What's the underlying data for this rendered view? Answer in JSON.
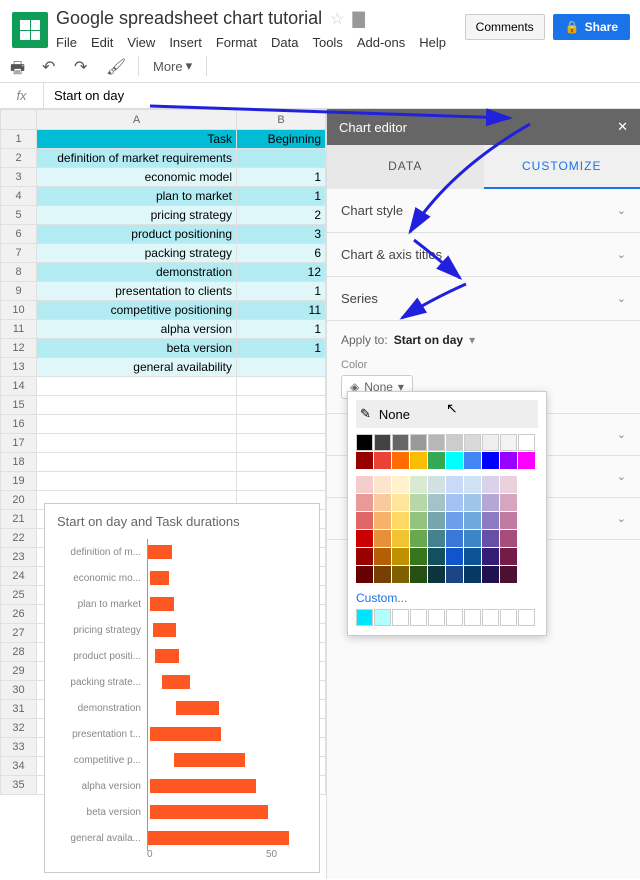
{
  "doc_title": "Google spreadsheet chart tutorial",
  "menus": [
    "File",
    "Edit",
    "View",
    "Insert",
    "Format",
    "Data",
    "Tools",
    "Add-ons",
    "Help"
  ],
  "buttons": {
    "comments": "Comments",
    "share": "Share"
  },
  "toolbar": {
    "more": "More"
  },
  "formula": {
    "fx": "fx",
    "value": "Start on day"
  },
  "columns": [
    "A",
    "B"
  ],
  "headers": {
    "task": "Task",
    "beginning": "Beginning"
  },
  "rows": [
    {
      "n": 1,
      "task": "Task",
      "b": "Beginning",
      "hdr": true
    },
    {
      "n": 2,
      "task": "definition of market requirements",
      "b": ""
    },
    {
      "n": 3,
      "task": "economic model",
      "b": "1"
    },
    {
      "n": 4,
      "task": "plan to market",
      "b": "1"
    },
    {
      "n": 5,
      "task": "pricing strategy",
      "b": "2"
    },
    {
      "n": 6,
      "task": "product positioning",
      "b": "3"
    },
    {
      "n": 7,
      "task": "packing strategy",
      "b": "6"
    },
    {
      "n": 8,
      "task": "demonstration",
      "b": "12"
    },
    {
      "n": 9,
      "task": "presentation to clients",
      "b": "1"
    },
    {
      "n": 10,
      "task": "competitive positioning",
      "b": "11"
    },
    {
      "n": 11,
      "task": "alpha version",
      "b": "1"
    },
    {
      "n": 12,
      "task": "beta version",
      "b": "1"
    },
    {
      "n": 13,
      "task": "general availability",
      "b": ""
    }
  ],
  "empty_rows": [
    14,
    15,
    16,
    17,
    18,
    19,
    20,
    21,
    22,
    23,
    24,
    25,
    26,
    27,
    28,
    29,
    30,
    31,
    32,
    33,
    34,
    35
  ],
  "chart_data": {
    "type": "bar",
    "title": "Start on day and Task durations",
    "categories": [
      "definition of m...",
      "economic mo...",
      "plan to market",
      "pricing strategy",
      "product positi...",
      "packing strate...",
      "demonstration",
      "presentation t...",
      "competitive p...",
      "alpha version",
      "beta version",
      "general availa..."
    ],
    "series": [
      {
        "name": "Start on day",
        "values": [
          0,
          1,
          1,
          2,
          3,
          6,
          12,
          1,
          11,
          1,
          1,
          0
        ]
      },
      {
        "name": "Task durations",
        "values": [
          10,
          8,
          10,
          10,
          10,
          12,
          18,
          30,
          30,
          45,
          50,
          60
        ]
      }
    ],
    "xlabel": "",
    "ylabel": "",
    "xlim": [
      0,
      70
    ],
    "ticks": [
      "0",
      "50"
    ]
  },
  "editor": {
    "title": "Chart editor",
    "tabs": {
      "data": "DATA",
      "customize": "CUSTOMIZE"
    },
    "sections": {
      "chart_style": "Chart style",
      "axis_titles": "Chart & axis titles",
      "series": "Series"
    },
    "apply_to_label": "Apply to:",
    "apply_to_value": "Start on day",
    "color_label": "Color",
    "none": "None",
    "custom": "Custom..."
  },
  "palette": {
    "grays": [
      "#000000",
      "#434343",
      "#666666",
      "#999999",
      "#b7b7b7",
      "#cccccc",
      "#d9d9d9",
      "#efefef",
      "#f3f3f3",
      "#ffffff"
    ],
    "brights": [
      "#ea4335",
      "#ff6d01",
      "#fbbc04",
      "#34a853",
      "#00ffff",
      "#4285f4",
      "#0000ff",
      "#9900ff",
      "#ff00ff"
    ],
    "tones": [
      [
        "#f4cccc",
        "#fce5cd",
        "#fff2cc",
        "#d9ead3",
        "#d0e0e3",
        "#c9daf8",
        "#cfe2f3",
        "#d9d2e9",
        "#ead1dc"
      ],
      [
        "#ea9999",
        "#f9cb9c",
        "#ffe599",
        "#b6d7a8",
        "#a2c4c9",
        "#a4c2f4",
        "#9fc5e8",
        "#b4a7d6",
        "#d5a6bd"
      ],
      [
        "#e06666",
        "#f6b26b",
        "#ffd966",
        "#93c47d",
        "#76a5af",
        "#6d9eeb",
        "#6fa8dc",
        "#8e7cc3",
        "#c27ba0"
      ],
      [
        "#cc0000",
        "#e69138",
        "#f1c232",
        "#6aa84f",
        "#45818e",
        "#3c78d8",
        "#3d85c6",
        "#674ea7",
        "#a64d79"
      ],
      [
        "#990000",
        "#b45f06",
        "#bf9000",
        "#38761d",
        "#134f5c",
        "#1155cc",
        "#0b5394",
        "#351c75",
        "#741b47"
      ],
      [
        "#660000",
        "#783f04",
        "#7f6000",
        "#274e13",
        "#0c343d",
        "#1c4587",
        "#073763",
        "#20124d",
        "#4c1130"
      ]
    ],
    "custom": [
      "#00e5ff",
      "#b2ffff"
    ]
  }
}
